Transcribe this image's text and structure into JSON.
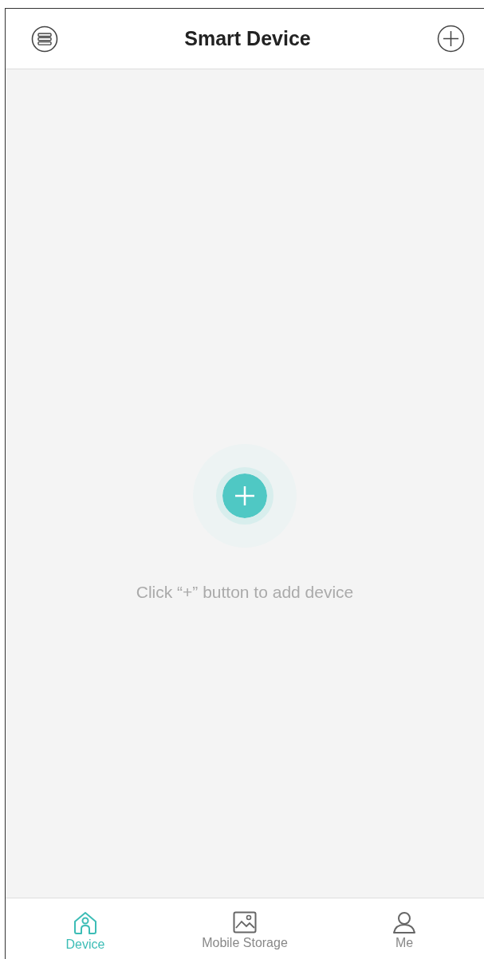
{
  "header": {
    "title": "Smart Device"
  },
  "empty_state": {
    "message": "Click “+” button to add device"
  },
  "tabs": [
    {
      "label": "Device",
      "selected": true
    },
    {
      "label": "Mobile Storage",
      "selected": false
    },
    {
      "label": "Me",
      "selected": false
    }
  ]
}
